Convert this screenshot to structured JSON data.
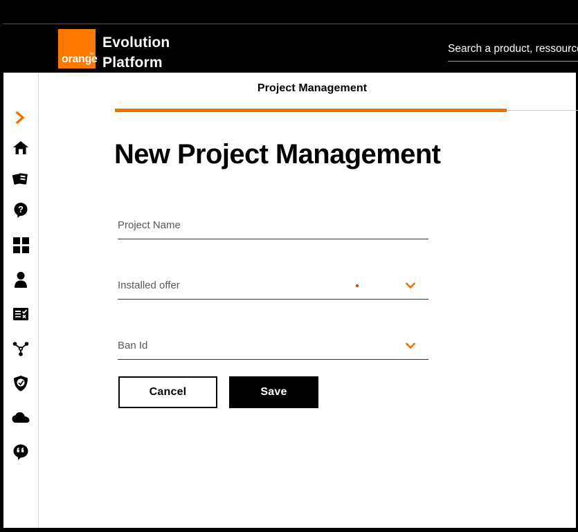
{
  "brand": {
    "logo_word": "orange",
    "logo_tm": "™",
    "name_line1": "Evolution",
    "name_line2": "Platform",
    "logo_color": "#FF7900"
  },
  "search": {
    "placeholder": "Search a product, ressource...",
    "value": ""
  },
  "sidebar": {
    "items": [
      {
        "name": "expand-sidebar",
        "icon": "chevron-right-icon",
        "color": "#F16E00"
      },
      {
        "name": "home",
        "icon": "home-icon",
        "color": "#000000"
      },
      {
        "name": "catalog",
        "icon": "cards-icon",
        "color": "#000000"
      },
      {
        "name": "help",
        "icon": "question-bubble-icon",
        "color": "#000000"
      },
      {
        "name": "dashboard",
        "icon": "grid-icon",
        "color": "#000000"
      },
      {
        "name": "account",
        "icon": "person-icon",
        "color": "#000000"
      },
      {
        "name": "orders",
        "icon": "checklist-icon",
        "color": "#000000"
      },
      {
        "name": "topology",
        "icon": "network-icon",
        "color": "#000000"
      },
      {
        "name": "security",
        "icon": "shield-icon",
        "color": "#000000"
      },
      {
        "name": "cloud",
        "icon": "cloud-icon",
        "color": "#000000"
      },
      {
        "name": "feedback",
        "icon": "quote-bubble-icon",
        "color": "#000000"
      }
    ]
  },
  "main": {
    "tab_label": "Project Management",
    "tab_active_color": "#F16E00",
    "page_title": "New Project Management",
    "fields": [
      {
        "label": "Project Name",
        "value": "",
        "type": "text",
        "has_chevron": false,
        "required_dot": false
      },
      {
        "label": "Installed offer",
        "value": "",
        "type": "select",
        "has_chevron": true,
        "required_dot": true,
        "dot_color": "#CD3C14"
      },
      {
        "label": "Ban Id",
        "value": "",
        "type": "select",
        "has_chevron": true,
        "required_dot": false
      }
    ],
    "buttons": {
      "cancel_label": "Cancel",
      "save_label": "Save"
    }
  }
}
